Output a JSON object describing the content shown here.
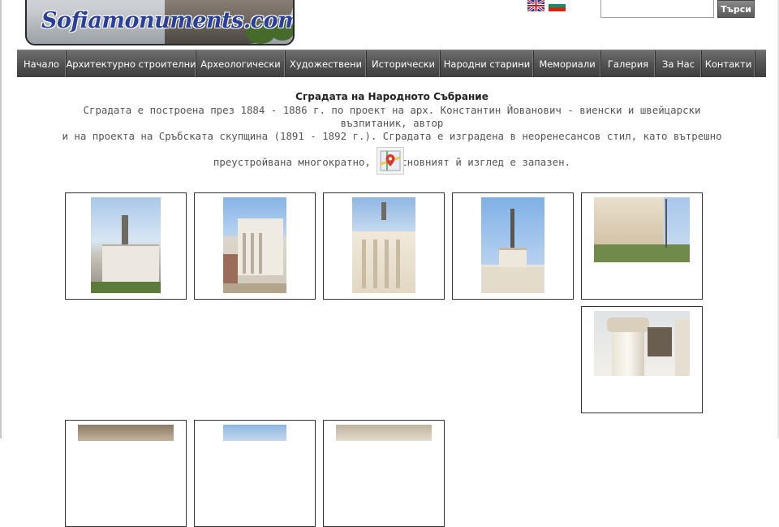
{
  "header": {
    "logo_text": "Sofiamonuments.com",
    "languages": [
      "English",
      "Български"
    ],
    "search": {
      "placeholder": "",
      "button_label": "Търси"
    }
  },
  "nav": {
    "items": [
      "Начало",
      "Архитектурно строителни",
      "Археологически",
      "Художествени",
      "Исторически",
      "Народни старини",
      "Мемориали",
      "Галерия",
      "За Нас",
      "Контакти"
    ]
  },
  "content": {
    "title": "Сградата на Народното Събрание",
    "description_lines": [
      "Сградата е построена през 1884 - 1886 г. по проект на арх. Константин Йованович - виенски и швейцарски възпитаник, автор",
      "и на проекта на Сръбската скупщина (1891 - 1892 г.). Сградата е изградена в неоренесансов стил, като вътрешно е",
      "преустройвана многократно, но основният й изглед е запазен."
    ],
    "map_icon": "map-pin-icon"
  },
  "gallery": {
    "count": 9,
    "colors": {
      "sky": "#8fb5e0",
      "facade": "#e8e3d8",
      "stone": "#b9a58a"
    }
  }
}
